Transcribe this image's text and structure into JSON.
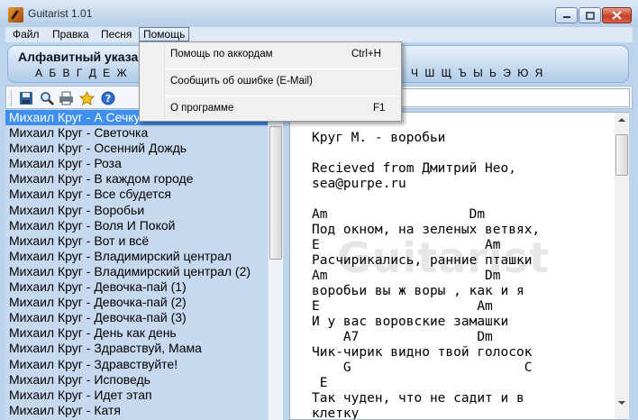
{
  "window": {
    "title": "Guitarist 1.01"
  },
  "menu": {
    "file": "Файл",
    "edit": "Правка",
    "song": "Песня",
    "help": "Помощь"
  },
  "help_menu": {
    "items": [
      {
        "label": "Помощь по аккордам",
        "shortcut": "Ctrl+H"
      },
      {
        "label": "Сообщить об ошибке (E-Mail)",
        "shortcut": ""
      },
      {
        "label": "О программе",
        "shortcut": "F1"
      }
    ]
  },
  "alphabet": {
    "title": "Алфавитный указа",
    "letters_left": "А Б В Г Д Е Ж",
    "letters_right": "Ч Ш Щ Ъ Ы Ь Э Ю Я"
  },
  "toolbar": {
    "icons": [
      "save-icon",
      "search-icon",
      "print-icon",
      "favorite-star-icon",
      "help-icon"
    ]
  },
  "songs": {
    "selected": "Михаил Круг - А Сечку",
    "items": [
      "Михаил Круг - Светочка",
      "Михаил Круг - Осенний Дождь",
      "Михаил Круг - Роза",
      "Михаил Круг - В каждом городе",
      "Михаил Круг - Все сбудется",
      "Михаил Круг - Воробьи",
      "Михаил Круг - Воля И Покой",
      "Михаил Круг - Вот и всё",
      "Михаил Круг - Владимирский централ",
      "Михаил Круг - Владимирский централ (2)",
      "Михаил Круг - Девочка-пай (1)",
      "Михаил Круг - Девочка-пай (2)",
      "Михаил Круг - Девочка-пай (3)",
      "Михаил Круг - День как день",
      "Михаил Круг - Здравствуй, Мама",
      "Михаил Круг - Здравствуйте!",
      "Михаил Круг - Исповедь",
      "Михаил Круг - Идет этап",
      "Михаил Круг - Катя"
    ]
  },
  "lyrics": {
    "watermark": "Guitarist",
    "text": "Круг М. - воробьи\n\nRecieved from Дмитрий Нео,\nsea@purpe.ru\n\nAm                  Dm\nПод окном, на зеленых ветвях,\nE                     Am\nРасчирикались, ранние пташки\nAm                    Dm\nворобьи вы ж воры , как и я\nE                    Am\nИ у вас воровские замашки\n    A7               Dm\nЧик-чирик видно твой голосок\n    G                      C\n E\nТак чуден, что не садит и в\nклетку\nAm                   Dm"
  }
}
